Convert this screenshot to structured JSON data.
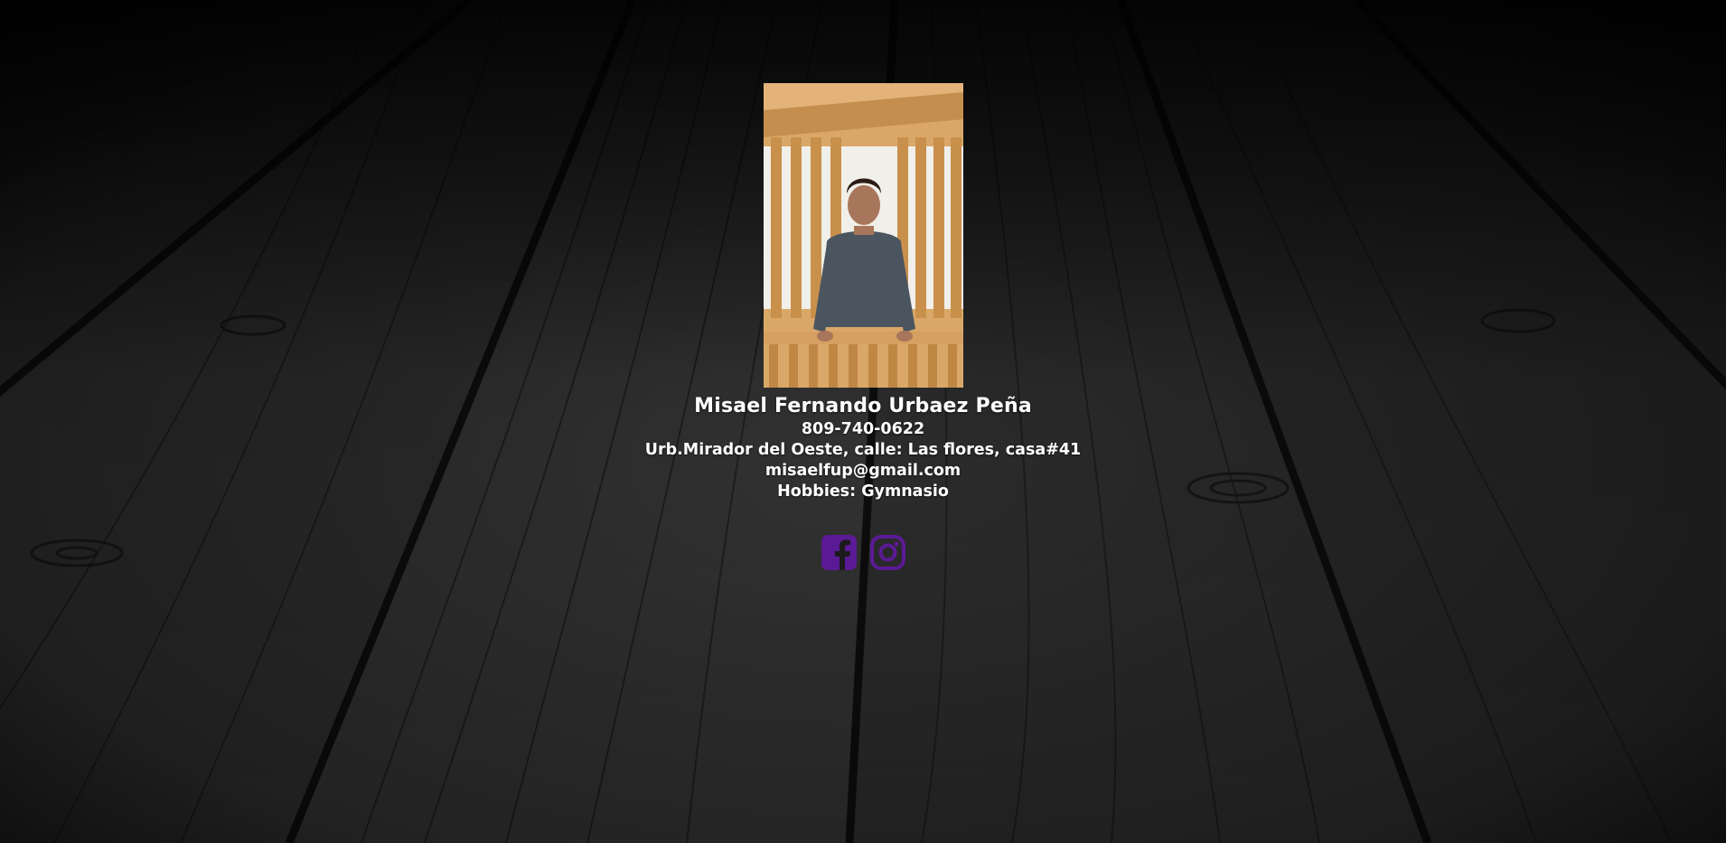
{
  "profile": {
    "name": "Misael Fernando Urbaez Peña",
    "phone": "809-740-0622",
    "address": "Urb.Mirador del Oeste, calle: Las flores, casa#41",
    "email": "misaelfup@gmail.com",
    "hobbies": "Hobbies: Gymnasio"
  },
  "social": [
    {
      "icon": "facebook-icon",
      "color": "#5b1a95"
    },
    {
      "icon": "instagram-icon",
      "color": "#5b1a95"
    }
  ],
  "colors": {
    "text": "#ffffff",
    "accent": "#5b1a95",
    "background": "#1a1a1a"
  }
}
